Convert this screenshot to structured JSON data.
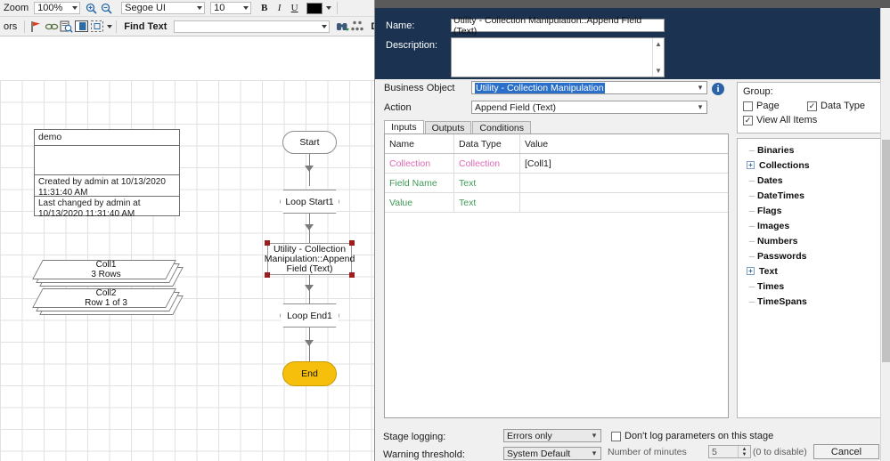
{
  "toolbar": {
    "zoom_label": "Zoom",
    "zoom_value": "100%",
    "zoom_in_icon": "zoom-in-icon",
    "zoom_out_icon": "zoom-out-icon",
    "font_family_value": "Segoe UI",
    "font_size_value": "10",
    "bold_label": "B",
    "italic_label": "I",
    "underline_label": "U",
    "color_swatch_hex": "#000000",
    "colors_label": "ors",
    "flag_icon": "red-flag-icon",
    "link_icon": "chain-link-icon",
    "search_props_icon": "search-properties-icon",
    "panel_icon": "panel-toggle-icon",
    "select_icon": "marquee-select-icon",
    "find_text_label": "Find Text",
    "find_text_value": "",
    "find_next_icon": "find-next-icon",
    "dependencies_icon": "dependencies-icon",
    "dependencies_label": "Depende"
  },
  "canvas": {
    "note": {
      "title": "demo",
      "created": "Created by admin at 10/13/2020 11:31:40 AM",
      "changed": "Last changed by admin at 10/13/2020 11:31:40 AM"
    },
    "collections": [
      {
        "name": "Coll1",
        "detail": "3 Rows"
      },
      {
        "name": "Coll2",
        "detail": "Row 1 of 3"
      }
    ],
    "nodes": [
      {
        "label": "Start",
        "type": "terminator"
      },
      {
        "label": "Loop Start1",
        "type": "loop-start"
      },
      {
        "label": "Utility - Collection Manipulation::Append Field (Text)",
        "type": "action",
        "selected": true
      },
      {
        "label": "Loop End1",
        "type": "loop-end"
      },
      {
        "label": "End",
        "type": "terminator-end",
        "color": "#f6bf0b"
      }
    ]
  },
  "dialog": {
    "name_label": "Name:",
    "name_value": "Utility - Collection Manipulation::Append Field (Text)",
    "description_label": "Description:",
    "description_value": "",
    "scroll_up_icon": "chevron-up-icon",
    "scroll_down_icon": "chevron-down-icon",
    "business_object_label": "Business Object",
    "business_object_value": "Utility - Collection Manipulation",
    "info_icon": "info-icon",
    "action_label": "Action",
    "action_value": "Append Field (Text)",
    "tabs": [
      {
        "label": "Inputs",
        "active": true
      },
      {
        "label": "Outputs",
        "active": false
      },
      {
        "label": "Conditions",
        "active": false
      }
    ],
    "grid": {
      "columns": [
        "Name",
        "Data Type",
        "Value"
      ],
      "rows": [
        {
          "name": "Collection",
          "data_type": "Collection",
          "value": "[Coll1]",
          "color": "#e06ab5"
        },
        {
          "name": "Field Name",
          "data_type": "Text",
          "value": "",
          "color": "#3f9a55"
        },
        {
          "name": "Value",
          "data_type": "Text",
          "value": "",
          "color": "#3f9a55"
        }
      ]
    },
    "group": {
      "title": "Group:",
      "page_label": "Page",
      "page_checked": false,
      "data_type_label": "Data Type",
      "data_type_checked": true,
      "view_all_label": "View All Items",
      "view_all_checked": true
    },
    "tree_items": [
      {
        "label": "Binaries",
        "expandable": false
      },
      {
        "label": "Collections",
        "expandable": true
      },
      {
        "label": "Dates",
        "expandable": false
      },
      {
        "label": "DateTimes",
        "expandable": false
      },
      {
        "label": "Flags",
        "expandable": false
      },
      {
        "label": "Images",
        "expandable": false
      },
      {
        "label": "Numbers",
        "expandable": false
      },
      {
        "label": "Passwords",
        "expandable": false
      },
      {
        "label": "Text",
        "expandable": true
      },
      {
        "label": "Times",
        "expandable": false
      },
      {
        "label": "TimeSpans",
        "expandable": false
      }
    ],
    "footer": {
      "stage_logging_label": "Stage logging:",
      "stage_logging_value": "Errors only",
      "dont_log_label": "Don't log parameters on this stage",
      "dont_log_checked": false,
      "warning_threshold_label": "Warning threshold:",
      "warning_threshold_value": "System Default",
      "minutes_label": "Number of minutes",
      "minutes_value": "5",
      "disable_hint": "(0 to disable)",
      "cancel_label": "Cancel"
    }
  }
}
